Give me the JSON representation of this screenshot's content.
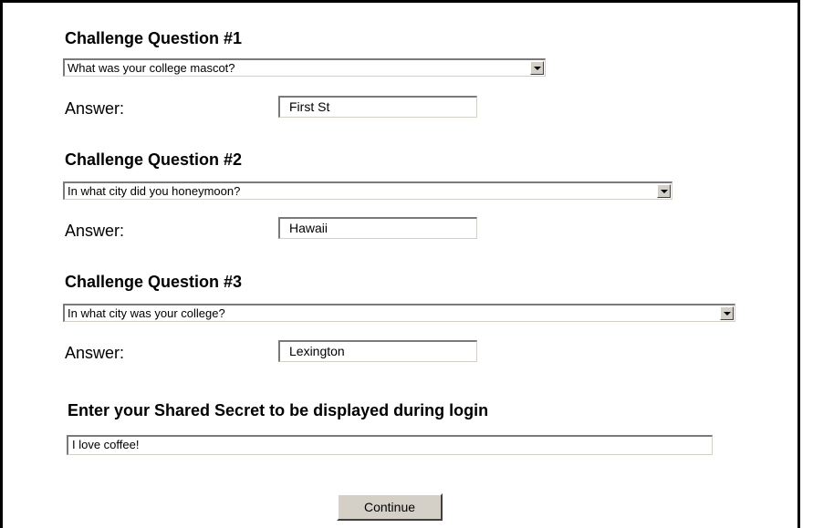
{
  "questions": [
    {
      "heading": "Challenge Question #1",
      "selected": "What was your college mascot?",
      "answer_label": "Answer:",
      "answer_value": "First St"
    },
    {
      "heading": "Challenge Question #2",
      "selected": "In what city did you honeymoon?",
      "answer_label": "Answer:",
      "answer_value": "Hawaii"
    },
    {
      "heading": "Challenge Question #3",
      "selected": "In what city was your college?",
      "answer_label": "Answer:",
      "answer_value": "Lexington"
    }
  ],
  "secret": {
    "heading": "Enter your Shared Secret to be displayed during login",
    "value": "I love coffee!"
  },
  "continue_label": "Continue",
  "icons": {
    "dropdown": "chevron-down-icon"
  }
}
